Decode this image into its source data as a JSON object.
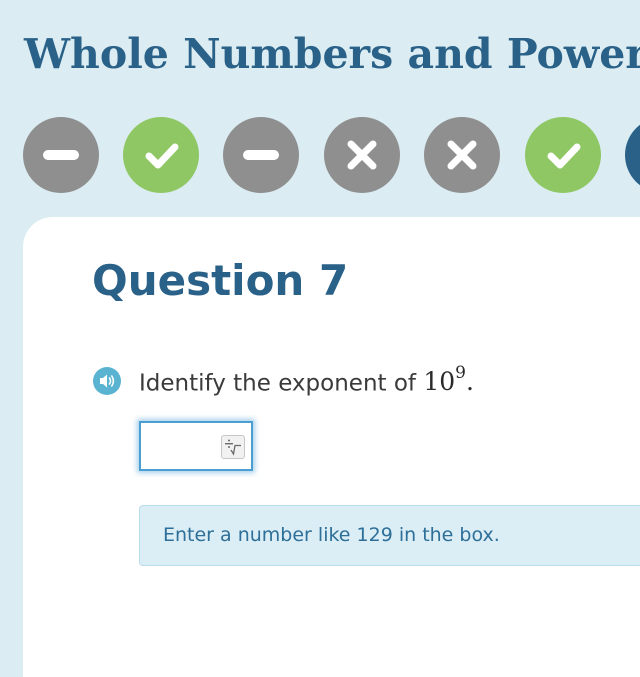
{
  "header": {
    "title": "Whole Numbers and Powers"
  },
  "progress": {
    "items": [
      {
        "status": "skipped",
        "icon": "minus-icon"
      },
      {
        "status": "correct",
        "icon": "check-icon"
      },
      {
        "status": "skipped",
        "icon": "minus-icon"
      },
      {
        "status": "wrong",
        "icon": "x-icon"
      },
      {
        "status": "wrong",
        "icon": "x-icon"
      },
      {
        "status": "correct",
        "icon": "check-icon"
      },
      {
        "status": "current",
        "icon": ""
      }
    ],
    "colors": {
      "skipped": "#8f8f8f",
      "wrong": "#8f8f8f",
      "correct": "#8fc765",
      "current": "#2a6188"
    }
  },
  "question": {
    "title": "Question 7",
    "prompt_text": "Identify the exponent of",
    "math_base": "10",
    "math_exponent": "9",
    "prompt_end": ".",
    "audio_icon": "speaker-icon",
    "answer_value": "",
    "keypad_icon": "math-keypad-icon"
  },
  "hint": {
    "text": "Enter a number like 129 in the box."
  },
  "colors": {
    "brand": "#2a6188",
    "background": "#dbedf2",
    "hint_bg": "#dbedf5",
    "hint_text": "#2d6f98",
    "audio": "#5ab3d1"
  }
}
